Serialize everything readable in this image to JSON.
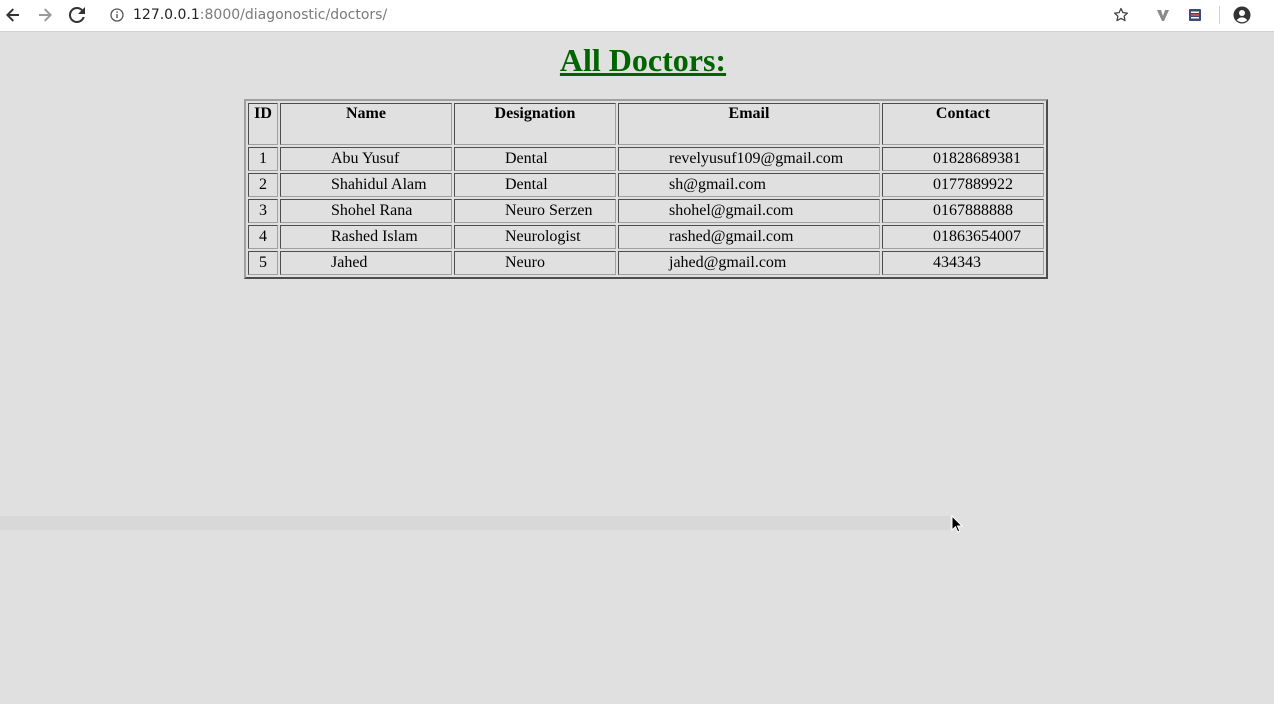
{
  "browser": {
    "url_host": "127.0.0.1",
    "url_rest": ":8000/diagonostic/doctors/"
  },
  "icons": {
    "back": "arrow-left-icon",
    "forward": "arrow-right-icon",
    "reload": "reload-icon",
    "info": "info-icon",
    "bookmark": "star-icon",
    "extension1": "v-extension-icon",
    "extension2": "menu-extension-icon",
    "profile": "account-icon"
  },
  "page": {
    "title": "All Doctors:",
    "title_color": "#006400"
  },
  "table": {
    "headers": [
      "ID",
      "Name",
      "Designation",
      "Email",
      "Contact"
    ],
    "rows": [
      {
        "id": "1",
        "name": "Abu Yusuf",
        "designation": "Dental",
        "email": "revelyusuf109@gmail.com",
        "contact": "01828689381"
      },
      {
        "id": "2",
        "name": "Shahidul Alam",
        "designation": "Dental",
        "email": "sh@gmail.com",
        "contact": "0177889922"
      },
      {
        "id": "3",
        "name": "Shohel Rana",
        "designation": "Neuro Serzen",
        "email": "shohel@gmail.com",
        "contact": "0167888888"
      },
      {
        "id": "4",
        "name": "Rashed Islam",
        "designation": "Neurologist",
        "email": "rashed@gmail.com",
        "contact": "01863654007"
      },
      {
        "id": "5",
        "name": "Jahed",
        "designation": "Neuro",
        "email": "jahed@gmail.com",
        "contact": "434343"
      }
    ]
  }
}
